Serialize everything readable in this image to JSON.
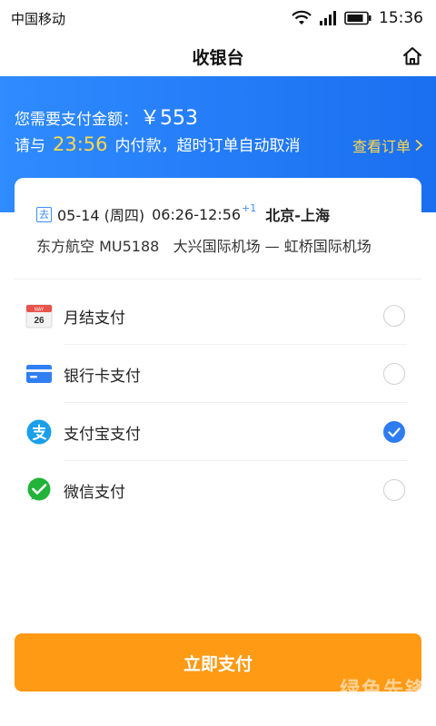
{
  "status_bar": {
    "carrier": "中国移动",
    "time": "15:36"
  },
  "nav": {
    "title": "收银台"
  },
  "header": {
    "amount_label": "您需要支付金额：",
    "amount_value": "￥553",
    "deadline_prefix": "请与",
    "deadline_time": "23:56",
    "deadline_suffix": "内付款，超时订单自动取消",
    "view_order_label": "查看订单"
  },
  "flight": {
    "tag": "去",
    "date": "05-14 (周四)",
    "times": "06:26-12:56",
    "plus_day": "+1",
    "route": "北京-上海",
    "airline_flight": "东方航空 MU5188",
    "airports": "大兴国际机场 — 虹桥国际机场"
  },
  "payment_methods": [
    {
      "label": "月结支付",
      "icon": "calendar-icon",
      "selected": false
    },
    {
      "label": "银行卡支付",
      "icon": "bank-card-icon",
      "selected": false
    },
    {
      "label": "支付宝支付",
      "icon": "alipay-icon",
      "selected": true
    },
    {
      "label": "微信支付",
      "icon": "wechat-icon",
      "selected": false
    }
  ],
  "calendar_icon": {
    "month": "MAY",
    "day": "26"
  },
  "pay_button": {
    "label": "立即支付"
  },
  "watermark": "绿色先锋",
  "colors": {
    "primary_blue": "#1a6ff0",
    "highlight_yellow": "#ffd84a",
    "pay_button": "#ff9a14",
    "check_blue": "#2d7cf0"
  }
}
